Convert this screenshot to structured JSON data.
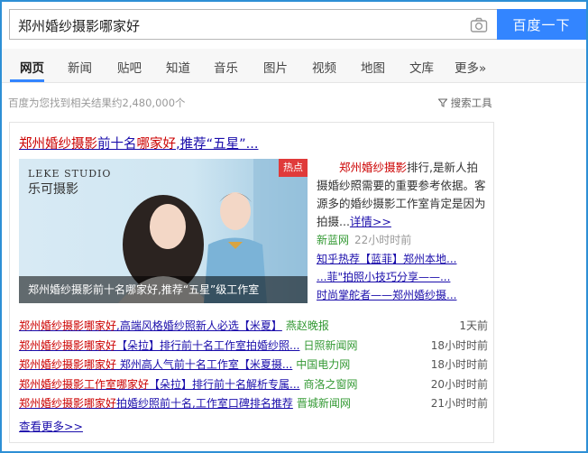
{
  "search": {
    "query": "郑州婚纱摄影哪家好",
    "button_label": "百度一下"
  },
  "tabs": [
    {
      "label": "网页",
      "active": true
    },
    {
      "label": "新闻"
    },
    {
      "label": "贴吧"
    },
    {
      "label": "知道"
    },
    {
      "label": "音乐"
    },
    {
      "label": "图片"
    },
    {
      "label": "视频"
    },
    {
      "label": "地图"
    },
    {
      "label": "文库"
    },
    {
      "label": "更多»"
    }
  ],
  "result_stats": "百度为您找到相关结果约2,480,000个",
  "search_tools": "搜索工具",
  "card": {
    "title_part1": "郑州婚纱摄影",
    "title_part2": "前十名",
    "title_part3": "哪家好",
    "title_part4": ",推荐“五星”...",
    "badge": "热点",
    "banner_caption": "郑州婚纱摄影前十名哪家好,推荐“五星”级工作室",
    "logo_line1": "LEKE STUDIO",
    "logo_line2": "乐可摄影",
    "snippet_red": "郑州婚纱摄影",
    "snippet_text": "排行,是新人拍摄婚纱照需要的重要参考依据。客源多的婚纱摄影工作室肯定是因为拍摄...",
    "snippet_link": "详情>>",
    "source_name": "新蓝网",
    "source_time": "22小时时前",
    "side_links": [
      "知乎热荐【蓝菲】郑州本地...",
      "...菲\"拍照小技巧分享——...",
      "时尚掌舵者——郑州婚纱摄..."
    ],
    "news": [
      {
        "red": "郑州婚纱摄影哪家好",
        "title": ",高端风格婚纱照新人必选【米夏】",
        "source": "燕赵晚报",
        "time": "1天前"
      },
      {
        "red": "郑州婚纱摄影哪家好",
        "title": "【朵拉】排行前十名工作室拍婚纱照...",
        "source": "日照新闻网",
        "time": "18小时时前"
      },
      {
        "red": "郑州婚纱摄影哪家好",
        "title": " 郑州高人气前十名工作室【米夏摄...",
        "source": "中国电力网",
        "time": "18小时时前"
      },
      {
        "red": "郑州婚纱摄影工作室哪家好",
        "title": "【朵拉】排行前十名解析专属...",
        "source": "商洛之窗网",
        "time": "20小时时前"
      },
      {
        "red": "郑州婚纱摄影哪家好",
        "title": "拍婚纱照前十名,工作室口碑排名推荐",
        "source": "晋城新闻网",
        "time": "21小时时前"
      }
    ],
    "more_label": "查看更多>>"
  },
  "colors": {
    "accent": "#3385ff",
    "frame": "#2d8fd5",
    "link": "#1a0dab",
    "highlight": "#c00000",
    "source": "#339933"
  }
}
